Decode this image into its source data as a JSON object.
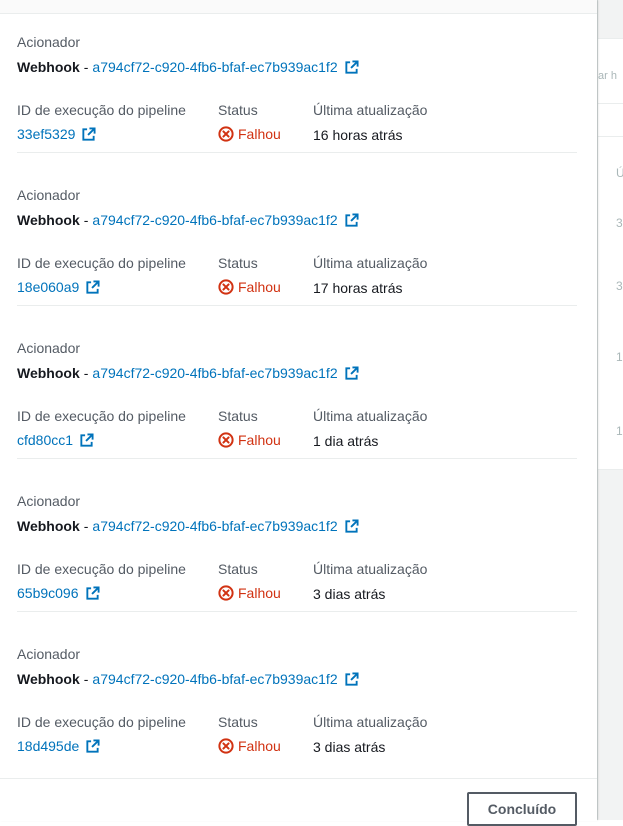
{
  "background": {
    "search_hint": "ar h",
    "column_hint": "Ú",
    "cells": [
      "3",
      "3",
      "1",
      "1"
    ]
  },
  "modal": {
    "labels": {
      "trigger": "Acionador",
      "execution_id": "ID de execução do pipeline",
      "status": "Status",
      "last_updated": "Última atualização"
    },
    "executions": [
      {
        "trigger_type": "Webhook",
        "trigger_id": "a794cf72-c920-4fb6-bfaf-ec7b939ac1f2",
        "execution_id": "33ef5329",
        "status": "Falhou",
        "last_updated": "16 horas atrás"
      },
      {
        "trigger_type": "Webhook",
        "trigger_id": "a794cf72-c920-4fb6-bfaf-ec7b939ac1f2",
        "execution_id": "18e060a9",
        "status": "Falhou",
        "last_updated": "17 horas atrás"
      },
      {
        "trigger_type": "Webhook",
        "trigger_id": "a794cf72-c920-4fb6-bfaf-ec7b939ac1f2",
        "execution_id": "cfd80cc1",
        "status": "Falhou",
        "last_updated": "1 dia atrás"
      },
      {
        "trigger_type": "Webhook",
        "trigger_id": "a794cf72-c920-4fb6-bfaf-ec7b939ac1f2",
        "execution_id": "65b9c096",
        "status": "Falhou",
        "last_updated": "3 dias atrás"
      },
      {
        "trigger_type": "Webhook",
        "trigger_id": "a794cf72-c920-4fb6-bfaf-ec7b939ac1f2",
        "execution_id": "18d495de",
        "status": "Falhou",
        "last_updated": "3 dias atrás"
      }
    ],
    "done_button": "Concluído"
  },
  "colors": {
    "link": "#0073bb",
    "error": "#d13212",
    "label": "#545b64",
    "text": "#16191f"
  },
  "icons": {
    "external_link": "external-link-icon",
    "status_failed": "status-failed-icon"
  }
}
